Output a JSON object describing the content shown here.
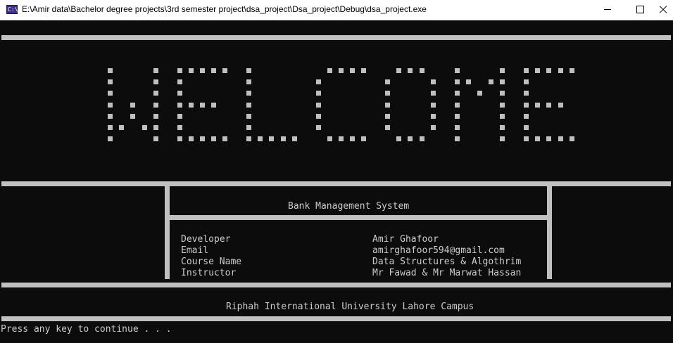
{
  "window": {
    "title": "E:\\Amir data\\Bachelor degree projects\\3rd semester project\\dsa_project\\Dsa_project\\Debug\\dsa_project.exe",
    "icon": "console-app-icon",
    "icon_text": "C:\\"
  },
  "console": {
    "banner_word": "WELCOME",
    "system_title": "Bank Management System",
    "info": [
      {
        "label": "Developer",
        "value": "Amir Ghafoor"
      },
      {
        "label": "Email",
        "value": "amirghafoor594@gmail.com"
      },
      {
        "label": "Course Name",
        "value": "Data Structures & Algothrim"
      },
      {
        "label": "Instructor",
        "value": "Mr Fawad & Mr Marwat Hassan"
      }
    ],
    "university": "Riphah International University Lahore Campus",
    "prompt": "Press any key to continue . . ."
  }
}
